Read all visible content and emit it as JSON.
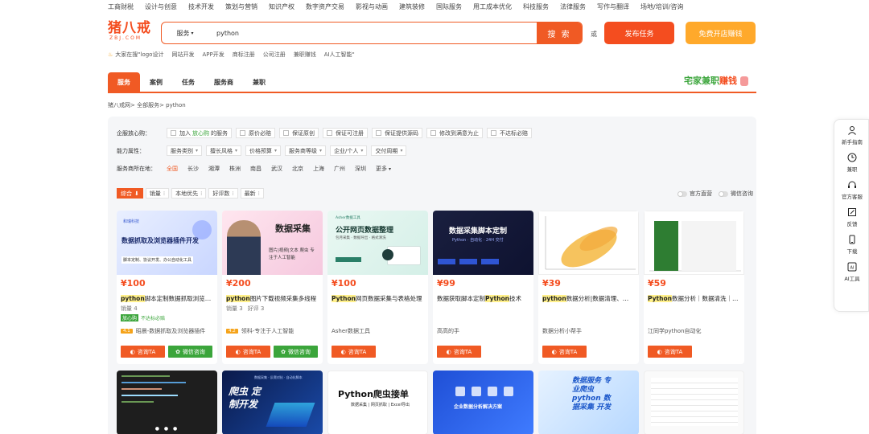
{
  "topnav": [
    "工商财税",
    "设计与创意",
    "技术开发",
    "策划与营销",
    "知识产权",
    "数字资产交易",
    "影视与动画",
    "建筑装修",
    "国际服务",
    "用工成本优化",
    "科技服务",
    "法律服务",
    "写作与翻译",
    "场地/培训/咨询"
  ],
  "logo": {
    "line1": "猪八戒",
    "line2": "ZBJ.COM"
  },
  "search": {
    "category": "服务",
    "value": "python",
    "button": "搜 索"
  },
  "or_text": "或",
  "publish_button": "发布任务",
  "shop_button": "免费开店赚钱",
  "hotwords": [
    "大家在搜\"logo设计",
    "网站开发",
    "APP开发",
    "商标注册",
    "公司注册",
    "兼职赚钱",
    "AI人工智能\""
  ],
  "tabs": [
    "服务",
    "案例",
    "任务",
    "服务商",
    "兼职"
  ],
  "promo": {
    "green": "宅家兼职",
    "red": "赚钱"
  },
  "breadcrumb": "猪八戒网> 全部服务> python",
  "filters": {
    "guarantee_label": "企服放心购：",
    "guarantee_options": [
      {
        "pre": "加入",
        "hl": "放心购",
        "post": "的服务"
      },
      {
        "pre": "",
        "hl": "",
        "post": "原价必赔"
      },
      {
        "pre": "",
        "hl": "",
        "post": "保证原创"
      },
      {
        "pre": "",
        "hl": "",
        "post": "保证可注册"
      },
      {
        "pre": "",
        "hl": "",
        "post": "保证提供源码"
      },
      {
        "pre": "",
        "hl": "",
        "post": "修改到满意为止"
      },
      {
        "pre": "",
        "hl": "",
        "post": "不达标必赔"
      }
    ],
    "ability_label": "能力属性：",
    "ability_options": [
      "服务类别",
      "擅长风格",
      "价格预算",
      "服务商等级",
      "企业/个人",
      "交付周期"
    ],
    "location_label": "服务商所在地：",
    "locations": [
      "全国",
      "长沙",
      "湘潭",
      "株洲",
      "南昌",
      "武汉",
      "北京",
      "上海",
      "广州",
      "深圳",
      "更多"
    ]
  },
  "sort": [
    "综合",
    "销量",
    "本地优先",
    "好评数",
    "最新"
  ],
  "toggles": [
    "官方直营",
    "微信咨询"
  ],
  "cards": [
    {
      "img_title": "数据抓取及浏览器插件开发",
      "img_sub": "脚本定制、协议开发、办公自动化工具",
      "img_logo": "和瑞科技",
      "price": "¥100",
      "title_hl": "python",
      "title_rest": "脚本定制数据抓取浏览器插件开发",
      "sales": "销量 4",
      "rating": "",
      "badge_tag": "放心购",
      "badge_text": "不达标必赔",
      "shop_lv": "4.1",
      "shop": "昭晨-数据抓取及浏览器插件",
      "consult": "咨询TA",
      "wechat": "微信咨询"
    },
    {
      "img_title": "数据采集",
      "img_sub": "图片|视频|文本 爬虫 专注于人工智能",
      "img_logo": "",
      "price": "¥200",
      "title_hl": "python",
      "title_rest": "图片下载视频采集多线程",
      "sales": "销量 3",
      "rating": "好评 3",
      "badge_tag": "",
      "badge_text": "",
      "shop_lv": "4.2",
      "shop": "领科-专注于人工智能",
      "consult": "咨询TA",
      "wechat": "微信咨询"
    },
    {
      "img_title": "公开网页数据整理",
      "img_sub": "包月采集 · 数据导出 · 格式清洗",
      "img_logo": "Asher数据工具",
      "price": "¥100",
      "title_hl": "Python",
      "title_rest": "网页数据采集与表格处理",
      "sales": "",
      "rating": "",
      "badge_tag": "",
      "badge_text": "",
      "shop_lv": "",
      "shop": "Asher数据工具",
      "consult": "咨询TA",
      "wechat": ""
    },
    {
      "img_title": "数据采集脚本定制",
      "img_sub": "Python · 自动化 · 24H 交付",
      "img_logo": "",
      "price": "¥99",
      "title_hl": "",
      "title_rest": "数据获取脚本定制",
      "title_hl2": "Python",
      "title_rest2": "技术",
      "sales": "",
      "rating": "",
      "badge_tag": "",
      "badge_text": "",
      "shop_lv": "",
      "shop": "高高的手",
      "consult": "咨询TA",
      "wechat": ""
    },
    {
      "img_title": "",
      "img_sub": "",
      "img_logo": "",
      "price": "¥39",
      "title_hl": "python",
      "title_rest": "数据分析|数据清理、可视化",
      "sales": "",
      "rating": "",
      "badge_tag": "",
      "badge_text": "",
      "shop_lv": "",
      "shop": "数据分析小帮手",
      "consult": "咨询TA",
      "wechat": ""
    },
    {
      "img_title": "",
      "img_sub": "",
      "img_logo": "",
      "price": "¥59",
      "title_hl": "Python",
      "title_rest": "数据分析｜数据清洗｜可视化",
      "sales": "",
      "rating": "",
      "badge_tag": "",
      "badge_text": "",
      "shop_lv": "",
      "shop": "江同学python自动化",
      "consult": "咨询TA",
      "wechat": ""
    }
  ],
  "row2": [
    {
      "title": "",
      "sub": ""
    },
    {
      "title": "爬虫 定制开发",
      "sub": "数据采集 · 反爬对抗 · 自动化脚本"
    },
    {
      "title": "Python爬虫接单",
      "sub": "数据采集 | 网页抓取 | Excel导出"
    },
    {
      "title": "企业数据分析解决方案",
      "sub": ""
    },
    {
      "title": "数据服务 专业爬虫 python 数据采集 开发",
      "sub": ""
    },
    {
      "title": "",
      "sub": ""
    }
  ],
  "sidebar": [
    "新手指南",
    "兼职",
    "官方客服",
    "反馈",
    "下载",
    "AI工具"
  ],
  "colors": {
    "brand": "#f05a24",
    "green": "#3ba53b",
    "yellow": "#ffa92b"
  }
}
